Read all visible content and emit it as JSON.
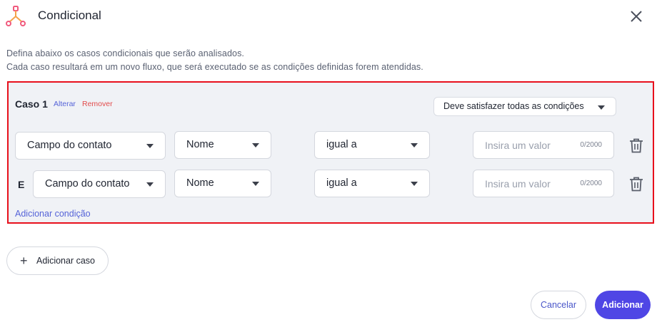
{
  "dialog": {
    "title": "Condicional",
    "icon": "branch-icon",
    "accent_color": "#f05a7e",
    "close_icon": "close-icon"
  },
  "description": {
    "line1": "Defina abaixo os casos condicionais que serão analisados.",
    "line2": "Cada caso resultará em um novo fluxo, que será executado se as condições definidas forem atendidas."
  },
  "case": {
    "title": "Caso 1",
    "alterar": "Alterar",
    "remover": "Remover",
    "match_mode": "Deve satisfazer todas as condições",
    "highlight_color": "#e8101c",
    "conditions": [
      {
        "connector": "",
        "field": "Campo do contato",
        "attribute": "Nome",
        "operator": "igual a",
        "value_placeholder": "Insira um valor",
        "counter": "0/2000"
      },
      {
        "connector": "E",
        "field": "Campo do contato",
        "attribute": "Nome",
        "operator": "igual a",
        "value_placeholder": "Insira um valor",
        "counter": "0/2000"
      }
    ],
    "add_condition": "Adicionar condição"
  },
  "add_case": {
    "label": "Adicionar caso",
    "icon": "plus-icon"
  },
  "footer": {
    "cancel": "Cancelar",
    "submit": "Adicionar",
    "primary_color": "#4f46e5"
  }
}
